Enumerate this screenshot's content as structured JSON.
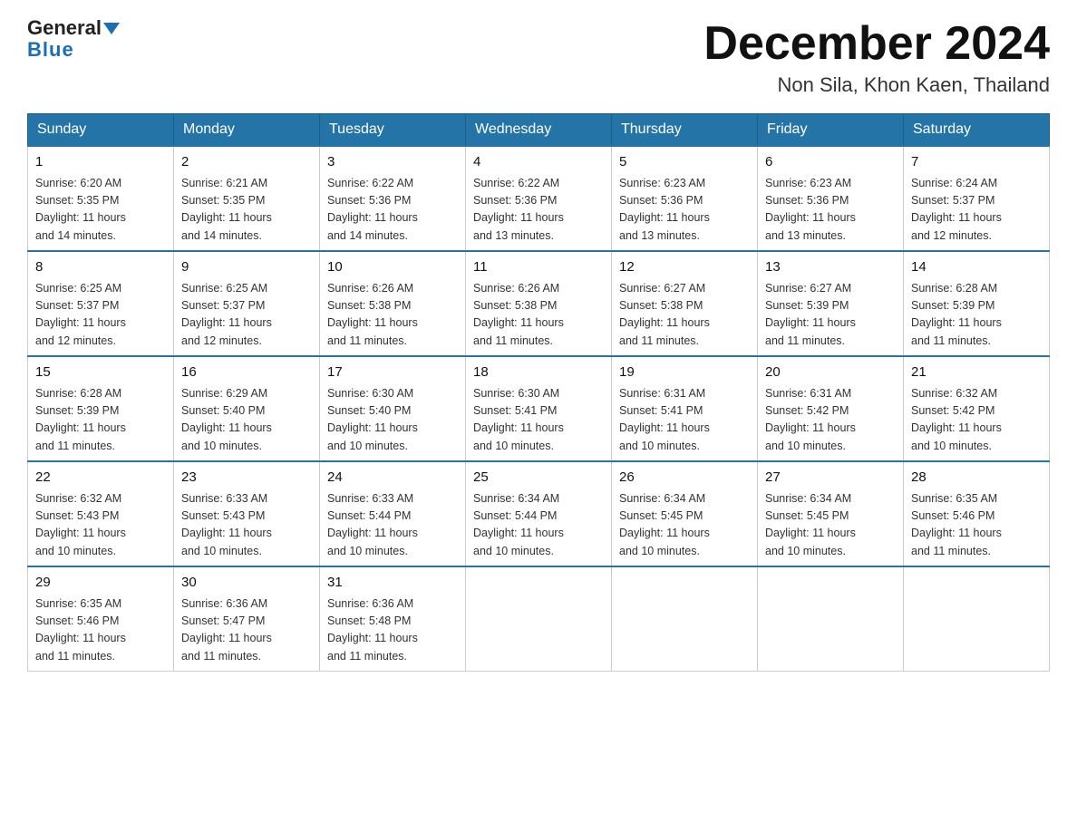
{
  "logo": {
    "general": "General",
    "blue": "Blue"
  },
  "title": "December 2024",
  "subtitle": "Non Sila, Khon Kaen, Thailand",
  "weekdays": [
    "Sunday",
    "Monday",
    "Tuesday",
    "Wednesday",
    "Thursday",
    "Friday",
    "Saturday"
  ],
  "weeks": [
    [
      {
        "day": "1",
        "sunrise": "6:20 AM",
        "sunset": "5:35 PM",
        "daylight": "11 hours and 14 minutes."
      },
      {
        "day": "2",
        "sunrise": "6:21 AM",
        "sunset": "5:35 PM",
        "daylight": "11 hours and 14 minutes."
      },
      {
        "day": "3",
        "sunrise": "6:22 AM",
        "sunset": "5:36 PM",
        "daylight": "11 hours and 14 minutes."
      },
      {
        "day": "4",
        "sunrise": "6:22 AM",
        "sunset": "5:36 PM",
        "daylight": "11 hours and 13 minutes."
      },
      {
        "day": "5",
        "sunrise": "6:23 AM",
        "sunset": "5:36 PM",
        "daylight": "11 hours and 13 minutes."
      },
      {
        "day": "6",
        "sunrise": "6:23 AM",
        "sunset": "5:36 PM",
        "daylight": "11 hours and 13 minutes."
      },
      {
        "day": "7",
        "sunrise": "6:24 AM",
        "sunset": "5:37 PM",
        "daylight": "11 hours and 12 minutes."
      }
    ],
    [
      {
        "day": "8",
        "sunrise": "6:25 AM",
        "sunset": "5:37 PM",
        "daylight": "11 hours and 12 minutes."
      },
      {
        "day": "9",
        "sunrise": "6:25 AM",
        "sunset": "5:37 PM",
        "daylight": "11 hours and 12 minutes."
      },
      {
        "day": "10",
        "sunrise": "6:26 AM",
        "sunset": "5:38 PM",
        "daylight": "11 hours and 11 minutes."
      },
      {
        "day": "11",
        "sunrise": "6:26 AM",
        "sunset": "5:38 PM",
        "daylight": "11 hours and 11 minutes."
      },
      {
        "day": "12",
        "sunrise": "6:27 AM",
        "sunset": "5:38 PM",
        "daylight": "11 hours and 11 minutes."
      },
      {
        "day": "13",
        "sunrise": "6:27 AM",
        "sunset": "5:39 PM",
        "daylight": "11 hours and 11 minutes."
      },
      {
        "day": "14",
        "sunrise": "6:28 AM",
        "sunset": "5:39 PM",
        "daylight": "11 hours and 11 minutes."
      }
    ],
    [
      {
        "day": "15",
        "sunrise": "6:28 AM",
        "sunset": "5:39 PM",
        "daylight": "11 hours and 11 minutes."
      },
      {
        "day": "16",
        "sunrise": "6:29 AM",
        "sunset": "5:40 PM",
        "daylight": "11 hours and 10 minutes."
      },
      {
        "day": "17",
        "sunrise": "6:30 AM",
        "sunset": "5:40 PM",
        "daylight": "11 hours and 10 minutes."
      },
      {
        "day": "18",
        "sunrise": "6:30 AM",
        "sunset": "5:41 PM",
        "daylight": "11 hours and 10 minutes."
      },
      {
        "day": "19",
        "sunrise": "6:31 AM",
        "sunset": "5:41 PM",
        "daylight": "11 hours and 10 minutes."
      },
      {
        "day": "20",
        "sunrise": "6:31 AM",
        "sunset": "5:42 PM",
        "daylight": "11 hours and 10 minutes."
      },
      {
        "day": "21",
        "sunrise": "6:32 AM",
        "sunset": "5:42 PM",
        "daylight": "11 hours and 10 minutes."
      }
    ],
    [
      {
        "day": "22",
        "sunrise": "6:32 AM",
        "sunset": "5:43 PM",
        "daylight": "11 hours and 10 minutes."
      },
      {
        "day": "23",
        "sunrise": "6:33 AM",
        "sunset": "5:43 PM",
        "daylight": "11 hours and 10 minutes."
      },
      {
        "day": "24",
        "sunrise": "6:33 AM",
        "sunset": "5:44 PM",
        "daylight": "11 hours and 10 minutes."
      },
      {
        "day": "25",
        "sunrise": "6:34 AM",
        "sunset": "5:44 PM",
        "daylight": "11 hours and 10 minutes."
      },
      {
        "day": "26",
        "sunrise": "6:34 AM",
        "sunset": "5:45 PM",
        "daylight": "11 hours and 10 minutes."
      },
      {
        "day": "27",
        "sunrise": "6:34 AM",
        "sunset": "5:45 PM",
        "daylight": "11 hours and 10 minutes."
      },
      {
        "day": "28",
        "sunrise": "6:35 AM",
        "sunset": "5:46 PM",
        "daylight": "11 hours and 11 minutes."
      }
    ],
    [
      {
        "day": "29",
        "sunrise": "6:35 AM",
        "sunset": "5:46 PM",
        "daylight": "11 hours and 11 minutes."
      },
      {
        "day": "30",
        "sunrise": "6:36 AM",
        "sunset": "5:47 PM",
        "daylight": "11 hours and 11 minutes."
      },
      {
        "day": "31",
        "sunrise": "6:36 AM",
        "sunset": "5:48 PM",
        "daylight": "11 hours and 11 minutes."
      },
      null,
      null,
      null,
      null
    ]
  ],
  "labels": {
    "sunrise": "Sunrise:",
    "sunset": "Sunset:",
    "daylight": "Daylight:"
  }
}
